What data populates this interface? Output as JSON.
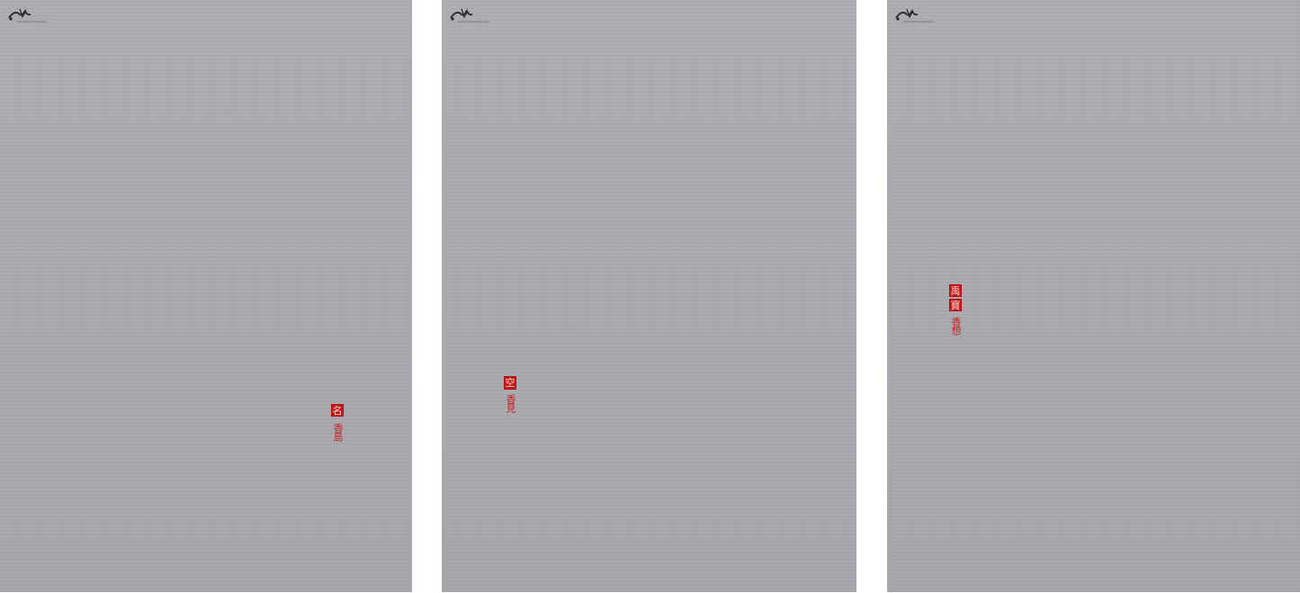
{
  "colors": {
    "background": "#ffffff",
    "paper": "#a9a9af",
    "seal_red": "#c8171b",
    "logo_ink": "#2a2a2e"
  },
  "panels": [
    {
      "logo_icon": "ink-brush-logo-icon",
      "seals": [
        "名"
      ],
      "signature": "香島"
    },
    {
      "logo_icon": "ink-brush-logo-icon",
      "seals": [
        "空"
      ],
      "signature": "香見"
    },
    {
      "logo_icon": "ink-brush-logo-icon",
      "seals": [
        "禹",
        "寶"
      ],
      "signature": "香想"
    }
  ]
}
